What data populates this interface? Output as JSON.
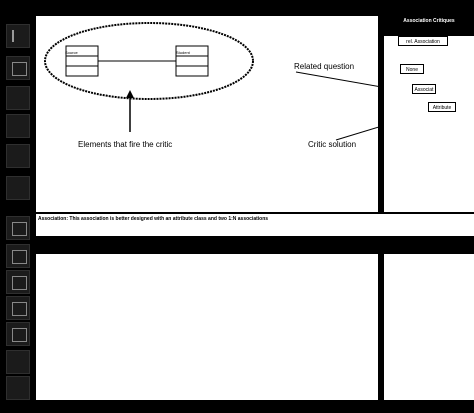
{
  "diagram": {
    "class_a_name": "Source",
    "class_b_name": "Student",
    "label_elements": "Elements that fire the critic",
    "label_related_question": "Related question",
    "label_critic_solution": "Critic solution"
  },
  "critics_panel": {
    "title": "Association Critiques",
    "button_label": "rel. Association",
    "items": [
      "None",
      "Associat",
      "Attribute"
    ]
  },
  "message": {
    "text": "Association: This association is better designed with an attribute class and two 1:N associations"
  },
  "colors": {
    "background": "#000000",
    "panel": "#ffffff",
    "ink": "#000000"
  }
}
